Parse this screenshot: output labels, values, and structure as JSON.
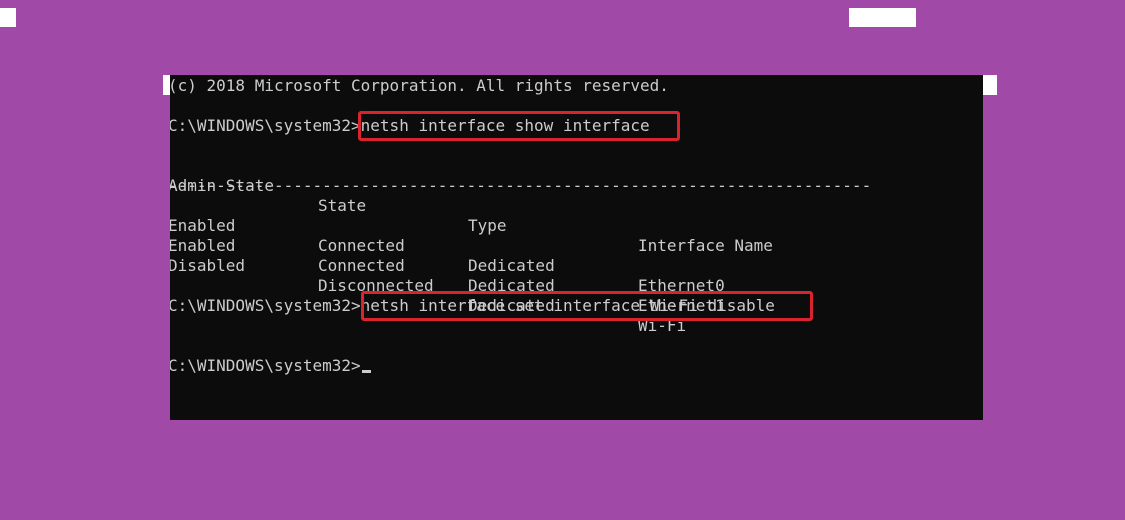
{
  "console": {
    "copyright": "(c) 2018 Microsoft Corporation. All rights reserved.",
    "prompt": "C:\\WINDOWS\\system32>",
    "command1": "netsh interface show interface",
    "header": {
      "admin_state": "Admin State",
      "state": "State",
      "type": "Type",
      "interface_name": "Interface Name"
    },
    "separator": "-------------------------------------------------------------------------",
    "rows": [
      {
        "admin_state": "Enabled",
        "state": "Connected",
        "type": "Dedicated",
        "interface_name": "Ethernet0"
      },
      {
        "admin_state": "Enabled",
        "state": "Connected",
        "type": "Dedicated",
        "interface_name": "Ethernet1"
      },
      {
        "admin_state": "Disabled",
        "state": "Disconnected",
        "type": "Dedicated",
        "interface_name": "Wi-Fi"
      }
    ],
    "command2": "netsh interface set interface Wi-Fi disable"
  },
  "colors": {
    "background": "#a049a6",
    "console_bg": "#0c0c0c",
    "console_text": "#cccccc",
    "highlight_border": "#d9232e"
  }
}
